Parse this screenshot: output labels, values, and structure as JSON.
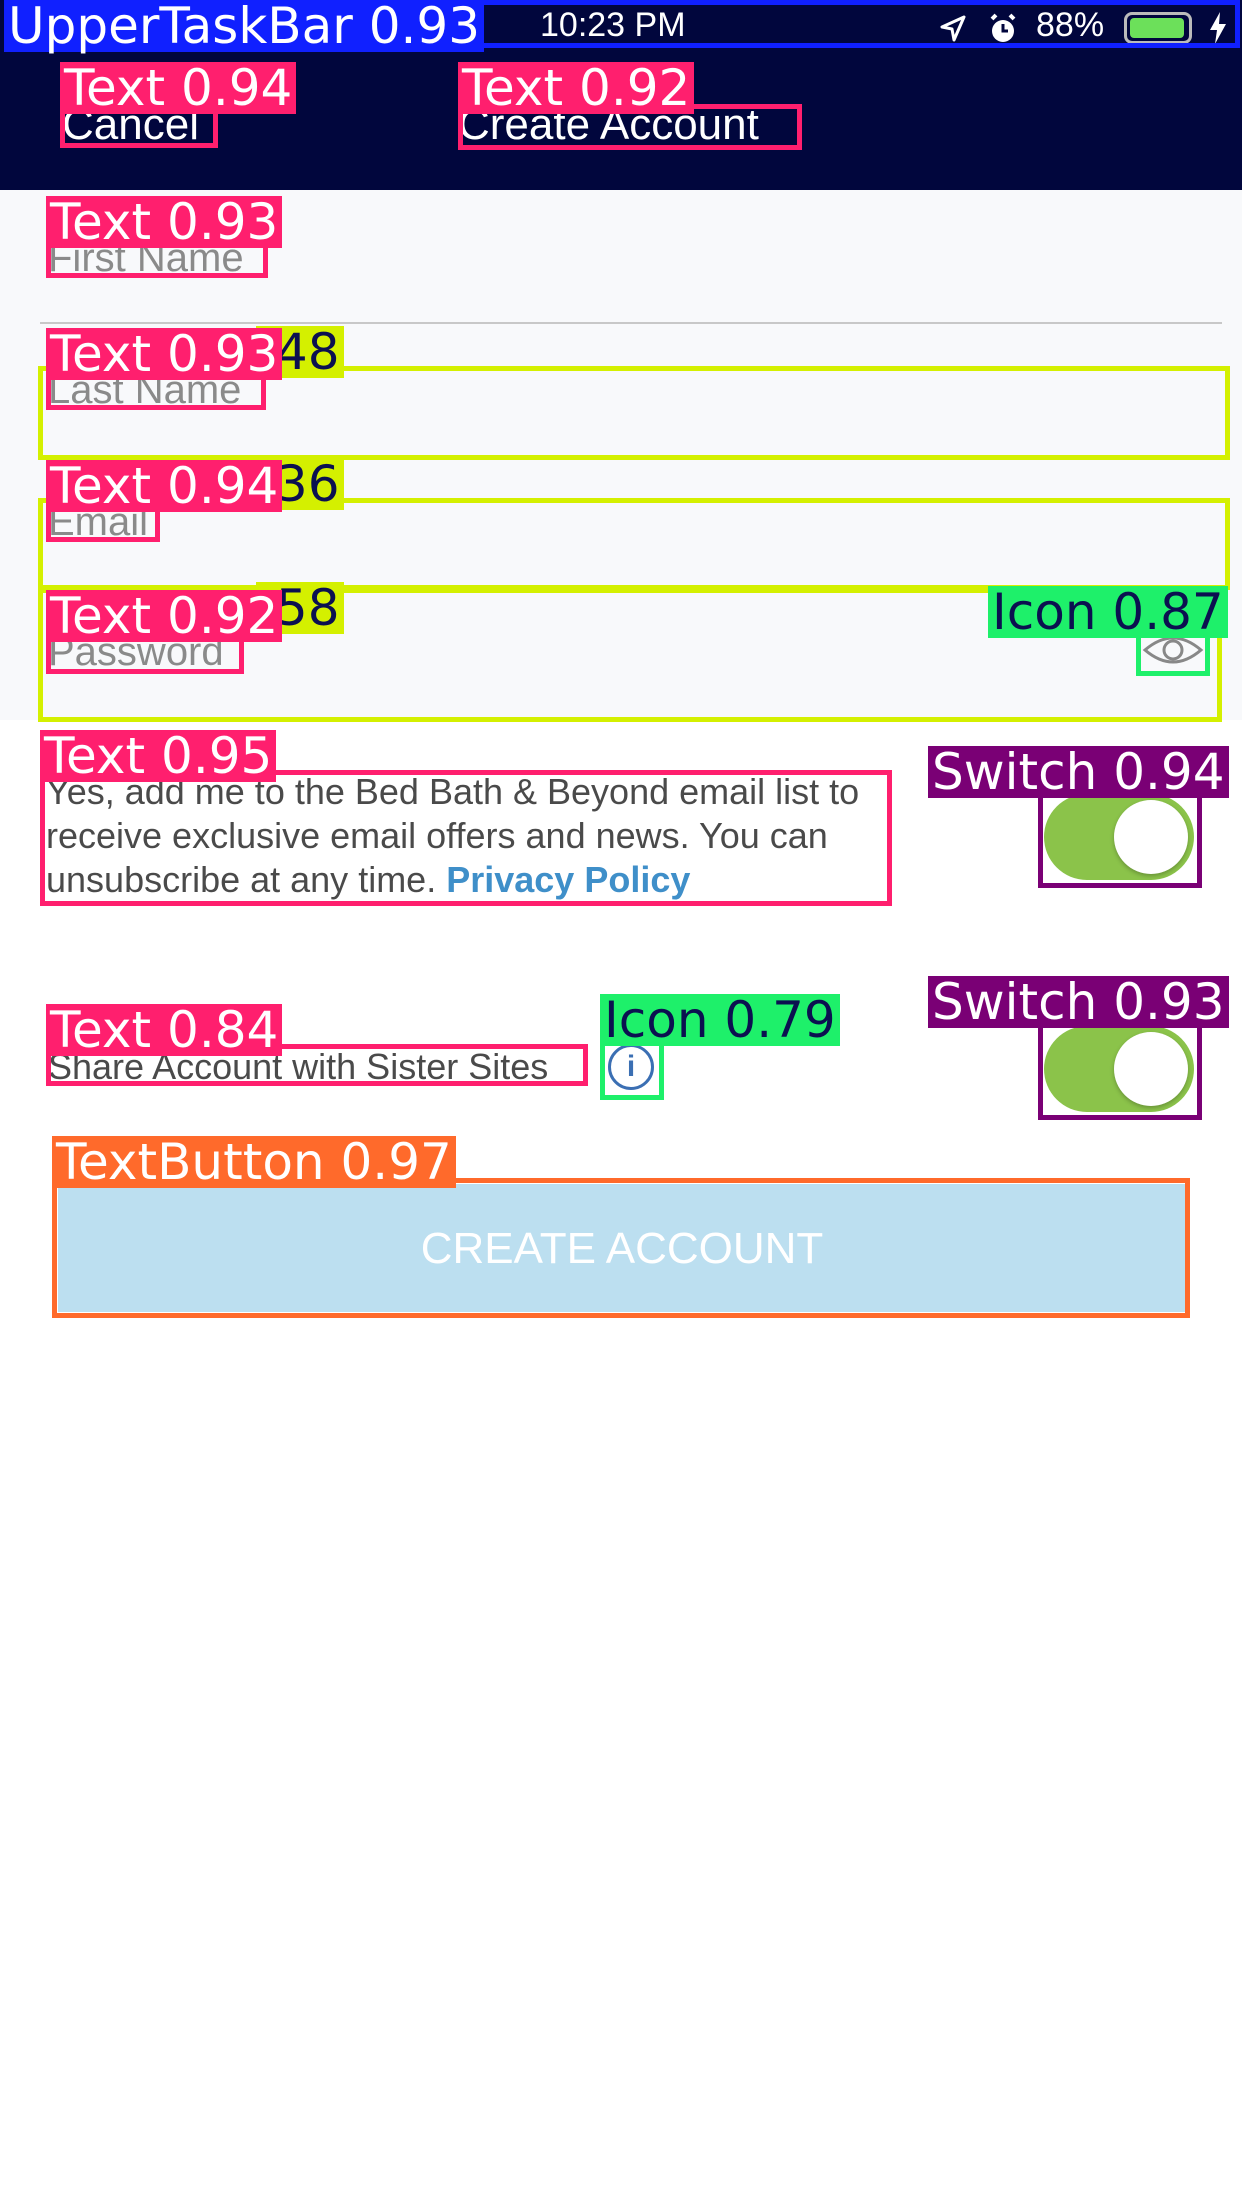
{
  "status_bar": {
    "time": "10:23 PM",
    "battery_percent": "88%"
  },
  "nav": {
    "cancel_label": "Cancel",
    "title": "Create Account"
  },
  "form": {
    "first_name_placeholder": "First Name",
    "last_name_placeholder": "Last Name",
    "email_placeholder": "Email",
    "password_placeholder": "Password"
  },
  "email_optin": {
    "text": "Yes, add me to the Bed Bath & Beyond email list to receive exclusive email offers and news. You can unsubscribe at any time.",
    "link_label": "Privacy Policy",
    "enabled": true
  },
  "share_account": {
    "label": "Share Account with Sister Sites",
    "enabled": true
  },
  "primary_action": {
    "label": "CREATE ACCOUNT"
  },
  "detections": [
    {
      "label": "UpperTaskBar 0.93"
    },
    {
      "label": "Text 0.94"
    },
    {
      "label": "Text 0.92"
    },
    {
      "label": "Text 0.93"
    },
    {
      "label": "Text 0.93"
    },
    {
      "label": ".48"
    },
    {
      "label": "Text 0.94"
    },
    {
      "label": ".36"
    },
    {
      "label": "Text 0.92"
    },
    {
      "label": ".58"
    },
    {
      "label": "Icon 0.87"
    },
    {
      "label": "Text 0.95"
    },
    {
      "label": "Switch 0.94"
    },
    {
      "label": "Text 0.84"
    },
    {
      "label": "Icon 0.79"
    },
    {
      "label": "Switch 0.93"
    },
    {
      "label": "TextButton 0.97"
    }
  ],
  "colors": {
    "topbar_bg": "#01063d",
    "accent_link": "#3f8fc9",
    "switch_on": "#8bc34a",
    "button_bg": "#bcdff0",
    "det_text": "#ff1f6e",
    "det_edittext": "#d4f000",
    "det_icon": "#1ef06a",
    "det_switch": "#7a0075",
    "det_button": "#ff6a2b",
    "det_taskbar": "#1020ff"
  }
}
